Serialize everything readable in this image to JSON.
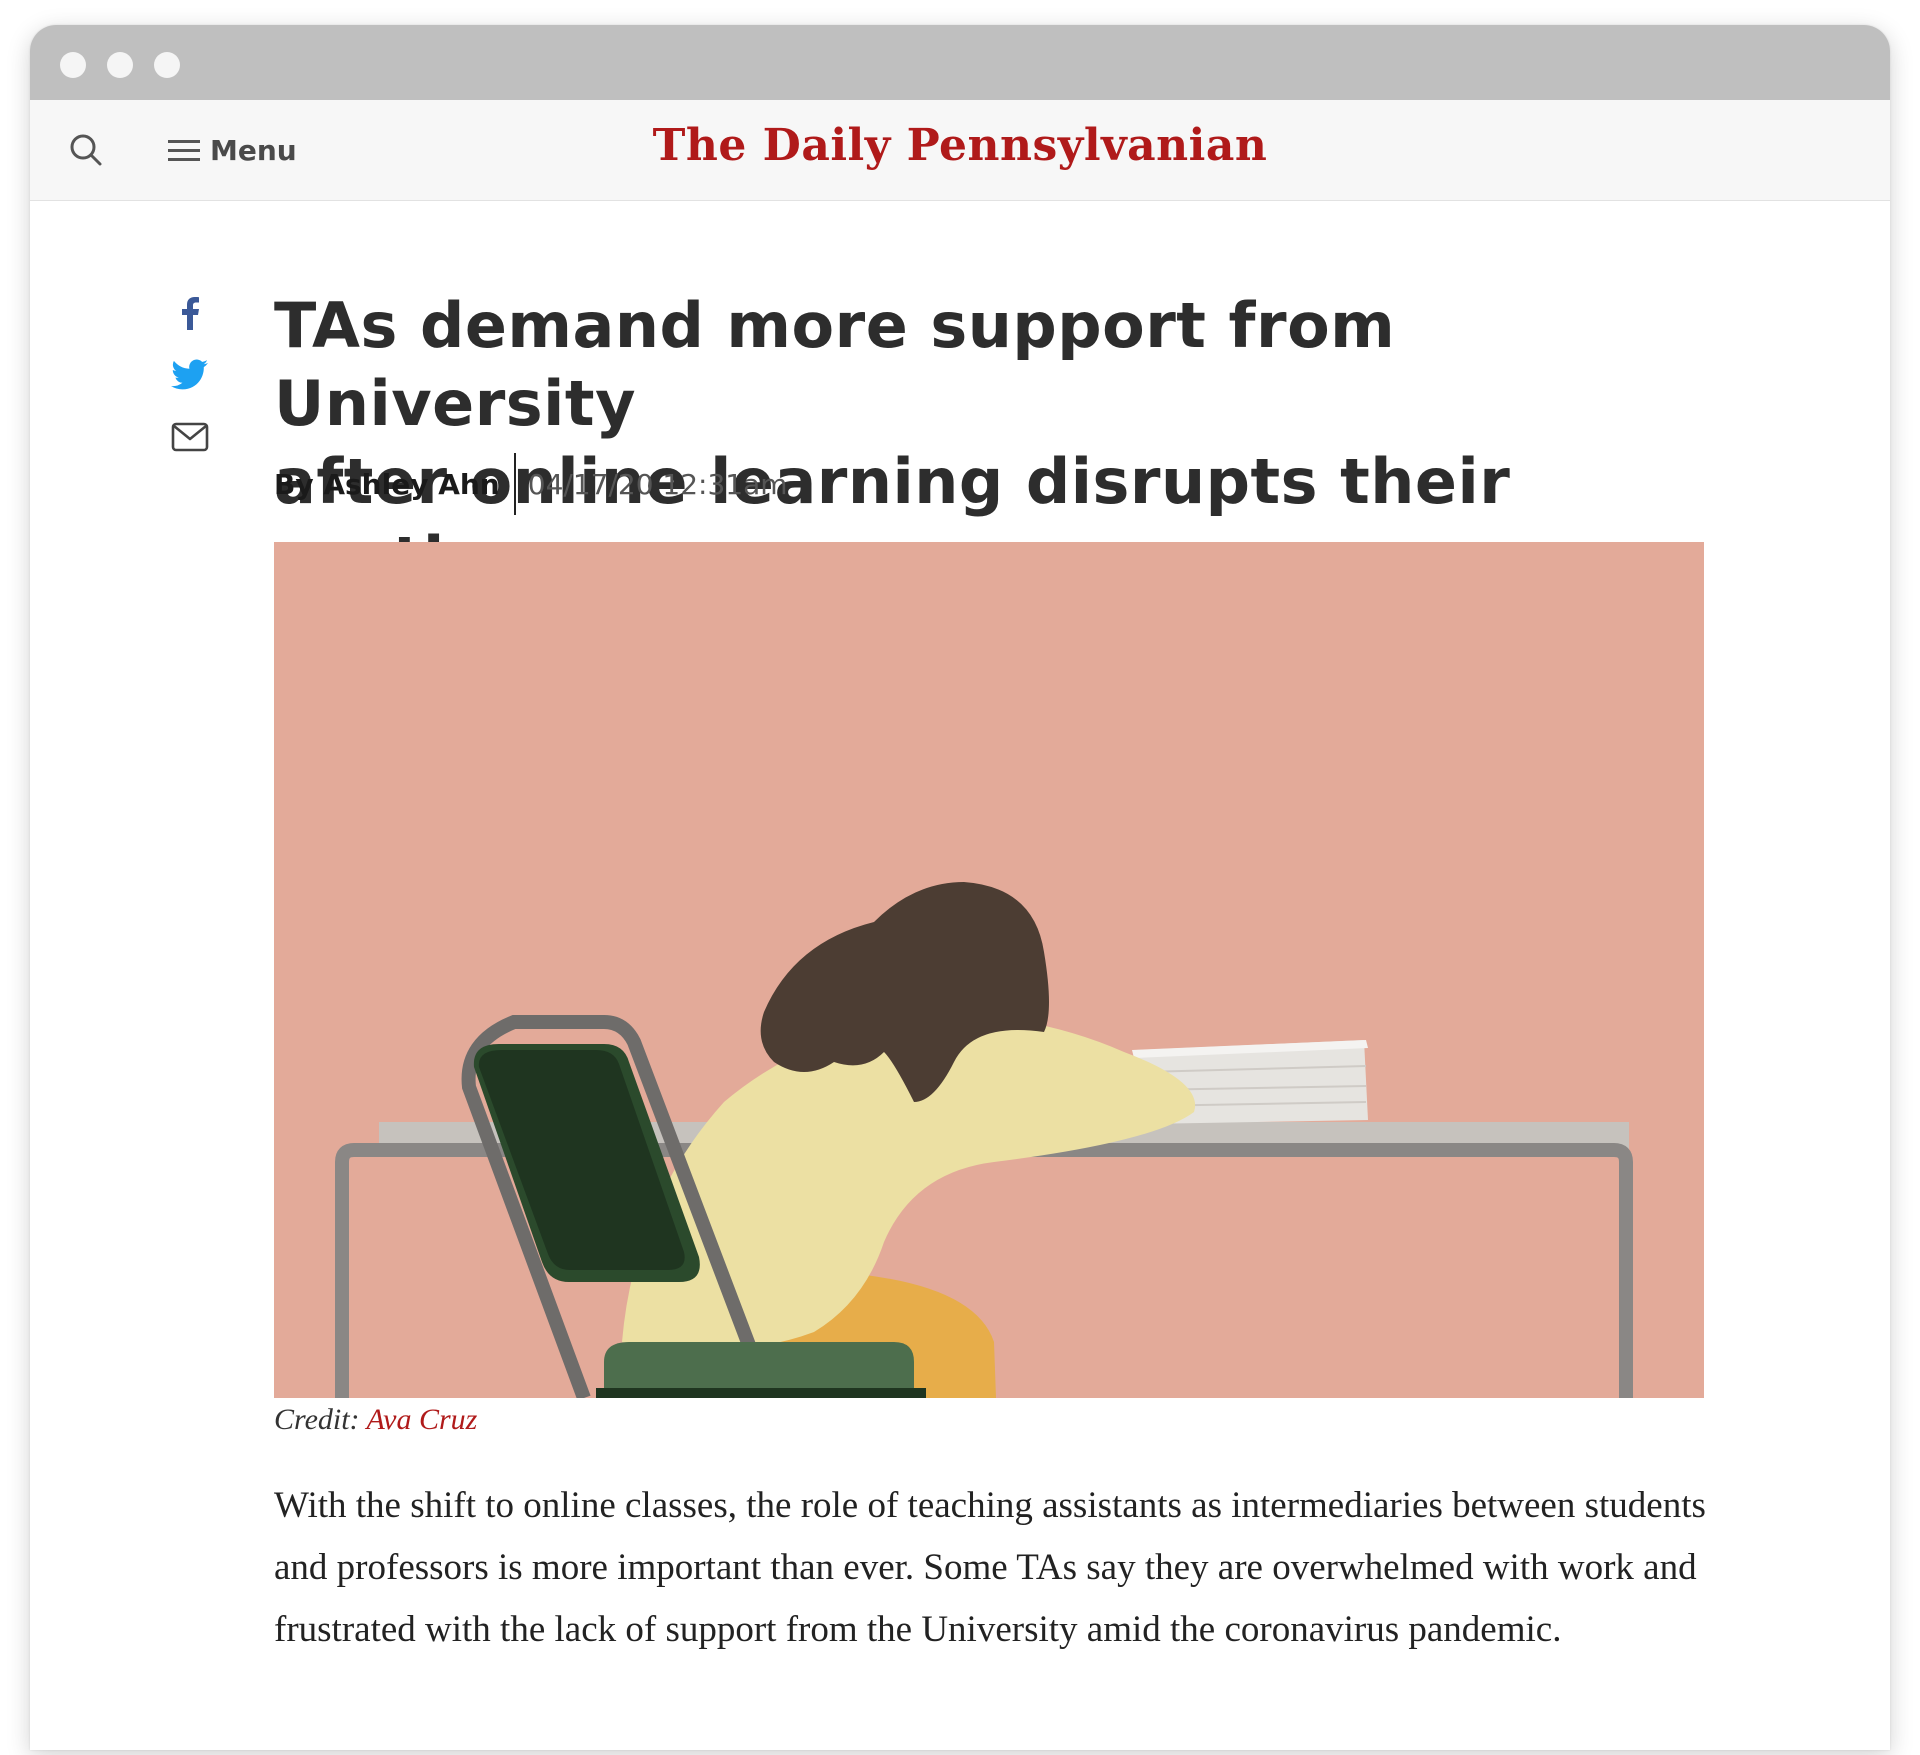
{
  "window": {
    "controls": [
      "window-dot",
      "window-dot",
      "window-dot"
    ]
  },
  "header": {
    "search_icon": "search-icon",
    "menu_icon": "hamburger-icon",
    "menu_label": "Menu",
    "site_name": "The Daily Pennsylvanian",
    "brand_color": "#b01a1a"
  },
  "share": {
    "icons": [
      "facebook-icon",
      "twitter-icon",
      "email-icon"
    ],
    "facebook_color": "#3b5998",
    "twitter_color": "#1da1f2"
  },
  "article": {
    "headline_line1": "TAs demand more support from University",
    "headline_line2": "after online learning disrupts their routines",
    "byline": "By Ashley Ahn",
    "date": "04/17/20 12:31am",
    "image": {
      "description_icon": "illustration-person-asleep-at-desk",
      "background_color": "#e3aa99"
    },
    "credit_label": "Credit:",
    "credit_name": "Ava Cruz",
    "lead_paragraph": "With the shift to online classes, the role of teaching assistants as intermediaries between students and professors is more important than ever. Some TAs say they are overwhelmed with work and frustrated with the lack of support from the University amid the coronavirus pandemic."
  }
}
